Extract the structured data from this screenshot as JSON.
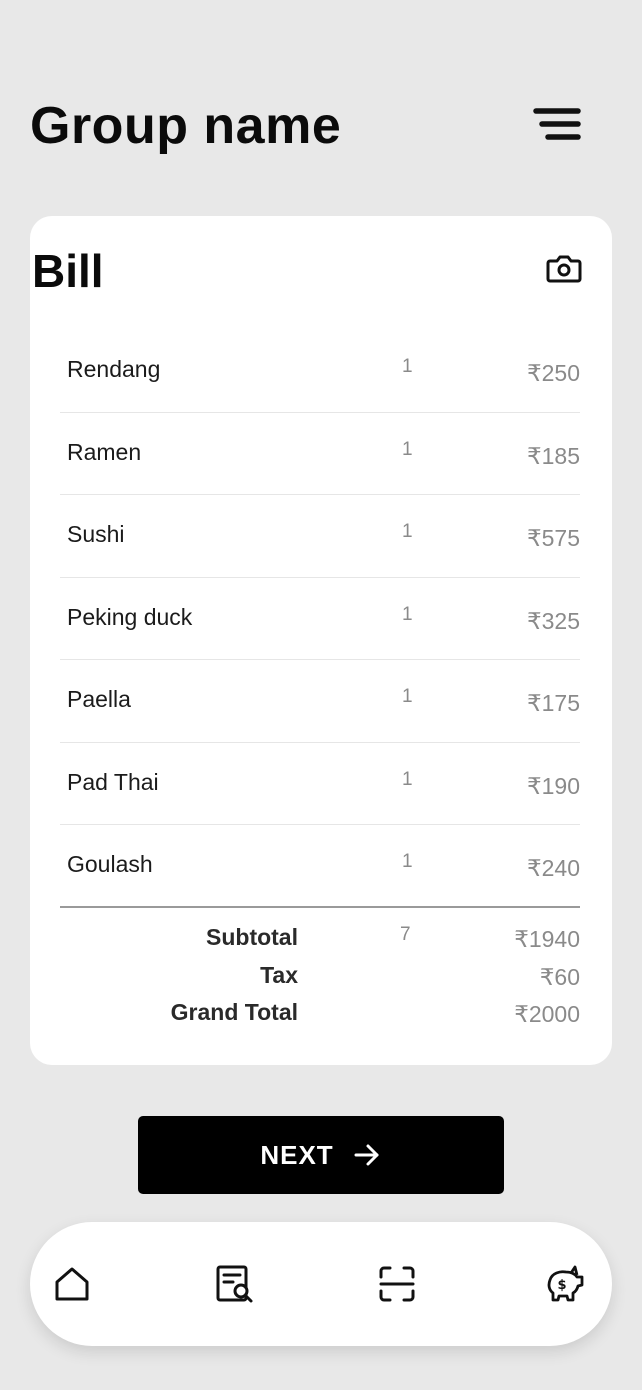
{
  "header": {
    "title": "Group name",
    "menu_icon": "menu-icon"
  },
  "bill": {
    "title": "Bill",
    "camera_icon": "camera-icon",
    "items": [
      {
        "name": "Rendang",
        "qty": "1",
        "price": "₹250"
      },
      {
        "name": "Ramen",
        "qty": "1",
        "price": "₹185"
      },
      {
        "name": "Sushi",
        "qty": "1",
        "price": "₹575"
      },
      {
        "name": "Peking duck",
        "qty": "1",
        "price": "₹325"
      },
      {
        "name": "Paella",
        "qty": "1",
        "price": "₹175"
      },
      {
        "name": "Pad Thai",
        "qty": "1",
        "price": "₹190"
      },
      {
        "name": "Goulash",
        "qty": "1",
        "price": "₹240"
      }
    ],
    "subtotal": {
      "label": "Subtotal",
      "qty": "7",
      "price": "₹1940"
    },
    "tax": {
      "label": "Tax",
      "price": "₹60"
    },
    "grand_total": {
      "label": "Grand Total",
      "price": "₹2000"
    }
  },
  "next_button": {
    "label": "NEXT",
    "icon": "arrow-right-icon"
  },
  "nav": {
    "items": [
      "home-icon",
      "receipt-search-icon",
      "scan-icon",
      "piggy-bank-icon"
    ]
  },
  "colors": {
    "background": "#e8e8e8",
    "card": "#ffffff",
    "button": "#000000",
    "muted_text": "#8a8a8a"
  }
}
